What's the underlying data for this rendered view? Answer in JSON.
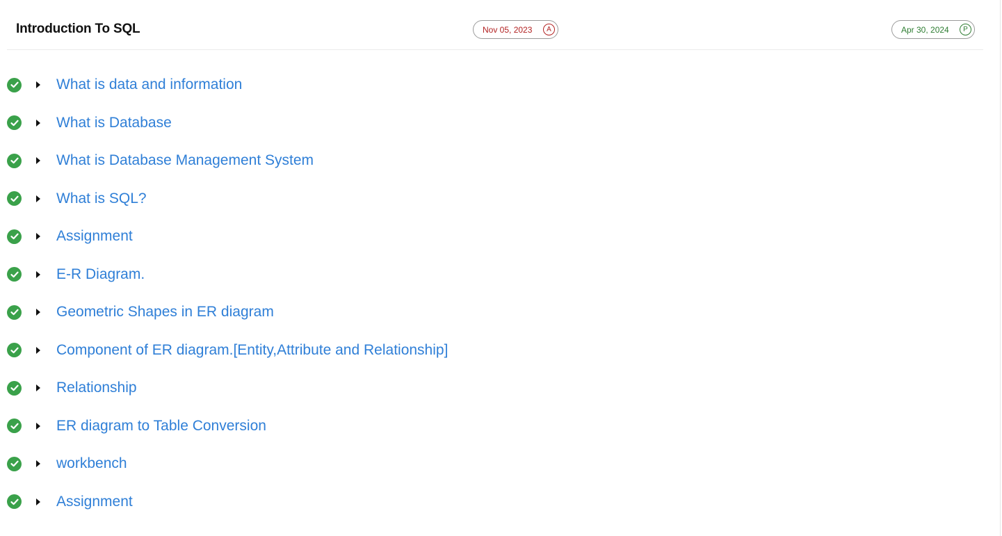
{
  "section": {
    "title": "Introduction To SQL",
    "start_date": "Nov 05, 2023",
    "start_badge": "A",
    "end_date": "Apr 30, 2024",
    "end_badge": "P"
  },
  "topics": [
    {
      "label": "What is data and information",
      "status_icon": "check-icon"
    },
    {
      "label": "What is Database",
      "status_icon": "check-icon"
    },
    {
      "label": "What is Database Management System",
      "status_icon": "check-icon"
    },
    {
      "label": "What is SQL?",
      "status_icon": "check-icon"
    },
    {
      "label": "Assignment",
      "status_icon": "check-icon"
    },
    {
      "label": "E-R Diagram.",
      "status_icon": "check-icon"
    },
    {
      "label": "Geometric Shapes in ER diagram",
      "status_icon": "check-icon"
    },
    {
      "label": "Component of ER diagram.[Entity,Attribute and Relationship]",
      "status_icon": "check-icon"
    },
    {
      "label": "Relationship",
      "status_icon": "check-icon"
    },
    {
      "label": "ER diagram to Table Conversion",
      "status_icon": "check-icon"
    },
    {
      "label": "workbench",
      "status_icon": "check-icon"
    },
    {
      "label": "Assignment",
      "status_icon": "check-icon"
    }
  ],
  "colors": {
    "link": "#2f7fd7",
    "check": "#3aa14a",
    "start_date": "#b22222",
    "end_date": "#2e7d32"
  }
}
